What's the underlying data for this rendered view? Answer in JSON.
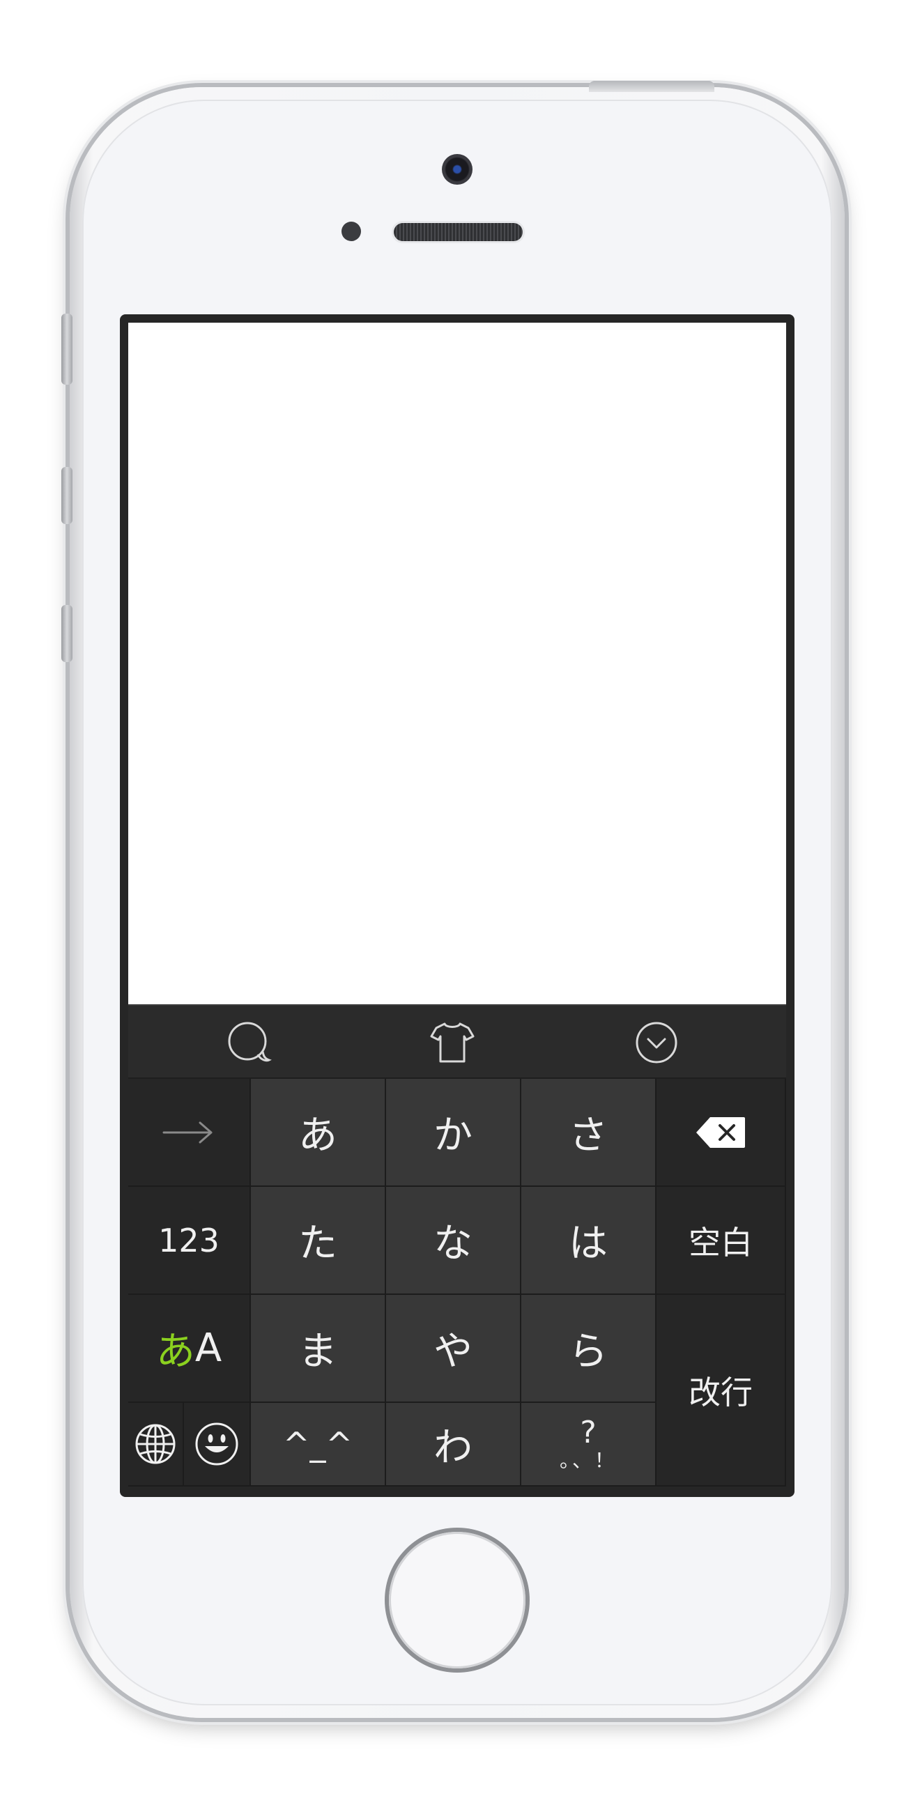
{
  "toolbar": {
    "icons": [
      "speech-bubble-icon",
      "tshirt-icon",
      "chevron-down-circle-icon"
    ]
  },
  "keys": {
    "arrow": "→",
    "row1": [
      "あ",
      "か",
      "さ"
    ],
    "backspace_icon": "backspace-icon",
    "numbers": "123",
    "row2": [
      "た",
      "な",
      "は"
    ],
    "space": "空白",
    "mode_hira": "あ",
    "mode_alpha": "A",
    "row3": [
      "ま",
      "や",
      "ら"
    ],
    "return": "改行",
    "globe_icon": "globe-icon",
    "emoji_icon": "smiley-icon",
    "kaomoji": "^_^",
    "wa": "わ",
    "punct_top": "?",
    "punct_bottom": "。、！"
  },
  "colors": {
    "mode_highlight": "#8bd11f"
  }
}
